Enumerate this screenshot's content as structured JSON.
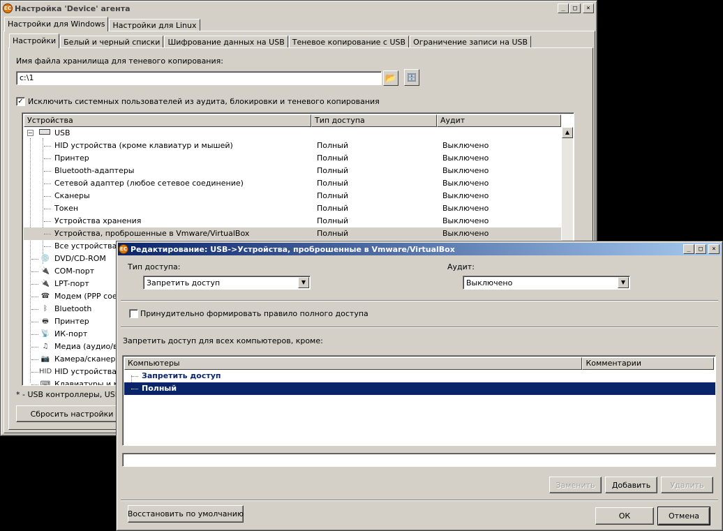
{
  "main_window": {
    "title": "Настройка 'Device' агента",
    "os_tabs": [
      "Настройки для Windows",
      "Настройки для Linux"
    ],
    "tabs": [
      "Настройки",
      "Белый и черный списки",
      "Шифрование данных на USB",
      "Теневое копирование с USB",
      "Ограничение записи на USB"
    ],
    "storage_label": "Имя файла хранилища для теневого копирования:",
    "storage_value": "c:\\1",
    "exclude_label": "Исключить системных пользователей из аудита, блокировки и теневого копирования",
    "exclude_checked": "✓",
    "columns": [
      "Устройства",
      "Тип доступа",
      "Аудит"
    ],
    "usb_root": "USB",
    "usb_children": [
      {
        "name": "HID устройства (кроме клавиатур и мышей)",
        "access": "Полный",
        "audit": "Выключено"
      },
      {
        "name": "Принтер",
        "access": "Полный",
        "audit": "Выключено"
      },
      {
        "name": "Bluetooth-адаптеры",
        "access": "Полный",
        "audit": "Выключено"
      },
      {
        "name": "Сетевой адаптер (любое сетевое соединение)",
        "access": "Полный",
        "audit": "Выключено"
      },
      {
        "name": "Сканеры",
        "access": "Полный",
        "audit": "Выключено"
      },
      {
        "name": "Токен",
        "access": "Полный",
        "audit": "Выключено"
      },
      {
        "name": "Устройства хранения",
        "access": "Полный",
        "audit": "Выключено"
      },
      {
        "name": "Устройства, проброшенные в Vmware/VirtualBox",
        "access": "Полный",
        "audit": "Выключено"
      },
      {
        "name": "Все устройства U",
        "access": "",
        "audit": ""
      }
    ],
    "other_devices": [
      {
        "name": "DVD/CD-ROM",
        "icon": "cdrom-icon",
        "glyph": "💿"
      },
      {
        "name": "COM-порт",
        "icon": "com-port-icon",
        "glyph": "🔌"
      },
      {
        "name": "LPT-порт",
        "icon": "lpt-port-icon",
        "glyph": "🔌"
      },
      {
        "name": "Модем (PPP соеди",
        "icon": "modem-icon",
        "glyph": "☎"
      },
      {
        "name": "Bluetooth",
        "icon": "bluetooth-icon",
        "glyph": "ᛒ"
      },
      {
        "name": "Принтер",
        "icon": "printer-icon",
        "glyph": "🖶"
      },
      {
        "name": "ИК-порт",
        "icon": "infrared-icon",
        "glyph": "📡"
      },
      {
        "name": "Медиа (аудио/ви",
        "icon": "media-icon",
        "glyph": "♫"
      },
      {
        "name": "Камера/сканер",
        "icon": "camera-icon",
        "glyph": "📷"
      },
      {
        "name": "HID устройства (ч",
        "icon": "hid-icon",
        "glyph": "HID"
      },
      {
        "name": "Клавиатуры и м",
        "icon": "keyboard-icon",
        "glyph": "⌨"
      }
    ],
    "footnote": "* - USB контроллеры, USB ко",
    "reset_button": "Сбросить настройки"
  },
  "dialog": {
    "title": "Редактирование: USB->Устройства, проброшенные в Vmware/VirtualBox",
    "access_label": "Тип доступа:",
    "access_value": "Запретить доступ",
    "audit_label": "Аудит:",
    "audit_value": "Выключено",
    "force_label": "Принудительно формировать правило полного доступа",
    "deny_label": "Запретить доступ для всех компьютеров, кроме:",
    "columns": [
      "Компьютеры",
      "Комментарии"
    ],
    "tree_items": [
      "Запретить доступ",
      "Полный"
    ],
    "input_value": "",
    "buttons": {
      "replace": "Заменить",
      "add": "Добавить",
      "delete": "Удалить",
      "restore": "Восстановить по умолчанию",
      "ok": "ОК",
      "cancel": "Отмена"
    }
  },
  "colors": {
    "active_title": "#0a246a",
    "selection": "#0a246a",
    "face": "#d4d0c8"
  }
}
